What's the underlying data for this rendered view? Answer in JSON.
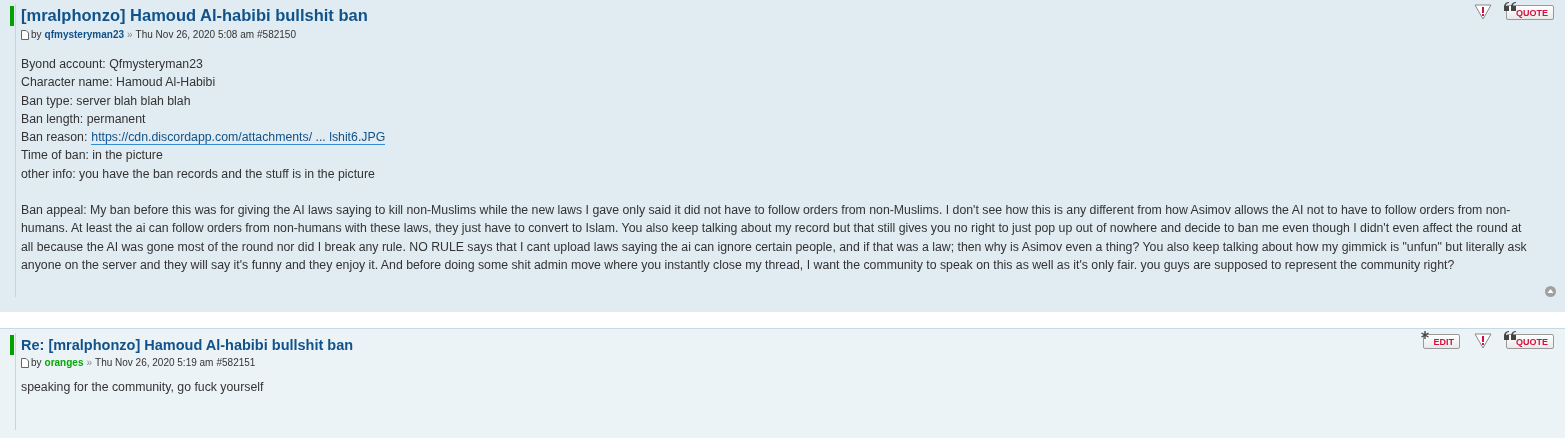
{
  "posts": [
    {
      "title": "[mralphonzo] Hamoud Al-habibi bullshit ban",
      "by": "by",
      "author": "qfmysteryman23",
      "color": "#105289",
      "sep": "»",
      "date": "Thu Nov 26, 2020 5:08 am",
      "post_id": "#582150",
      "buttons": [
        {
          "kind": "report"
        },
        {
          "kind": "quote",
          "label": "QUOTE"
        }
      ],
      "back_to_top": true,
      "paragraphs": [
        {
          "lines": [
            {
              "label": "Byond account:",
              "value": "Qfmysteryman23"
            },
            {
              "label": "Character name:",
              "value": "Hamoud Al-Habibi"
            },
            {
              "label": "Ban type:",
              "value": "server blah blah blah"
            },
            {
              "label": "Ban length:",
              "value": "permanent"
            },
            {
              "label": "Ban reason:",
              "link": "https://cdn.discordapp.com/attachments/ ... lshit6.JPG"
            },
            {
              "label": "Time of ban:",
              "value": "in the picture"
            },
            {
              "label": "other info:",
              "value": "you have the ban records and the stuff is in the picture"
            }
          ]
        },
        {
          "text": "Ban appeal: My ban before this was for giving the AI laws saying to kill non-Muslims while the new laws I gave only said it did not have to follow orders from non-Muslims. I don't see how this is any different from how Asimov allows the AI not to have to follow orders from non-humans. At least the ai can follow orders from non-humans with these laws, they just have to convert to Islam. You also keep talking about my record but that still gives you no right to just pop up out of nowhere and decide to ban me even though I didn't even affect the round at all because the AI was gone most of the round nor did I break any rule. NO RULE says that I cant upload laws saying the ai can ignore certain people, and if that was a law; then why is Asimov even a thing? You also keep talking about how my gimmick is \"unfun\" but literally ask anyone on the server and they will say it's funny and they enjoy it. And before doing some shit admin move where you instantly close my thread, I want the community to speak on this as well as it's only fair. you guys are supposed to represent the community right?"
        }
      ]
    },
    {
      "title": "Re: [mralphonzo] Hamoud Al-habibi bullshit ban",
      "by": "by",
      "author": "oranges",
      "color": "#00aa00",
      "sep": "»",
      "date": "Thu Nov 26, 2020 5:19 am",
      "post_id": "#582151",
      "buttons": [
        {
          "kind": "edit",
          "label": "EDIT"
        },
        {
          "kind": "report"
        },
        {
          "kind": "quote",
          "label": "QUOTE"
        }
      ],
      "back_to_top": false,
      "paragraphs": [
        {
          "text": "speaking for the community, go fuck yourself"
        }
      ]
    }
  ]
}
